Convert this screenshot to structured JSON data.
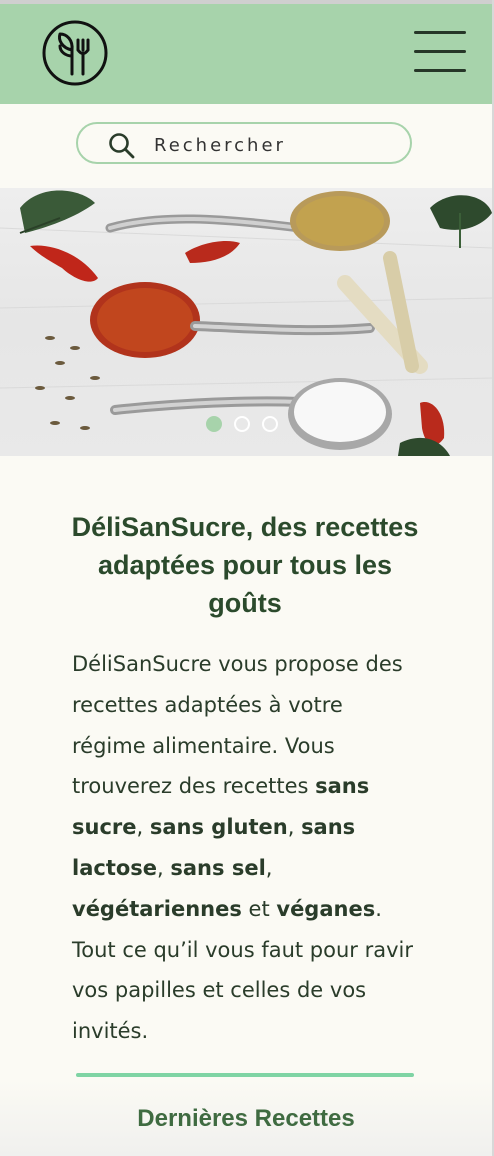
{
  "header": {
    "logo_icon": "leaf-fork-icon",
    "menu_icon": "hamburger-menu-icon"
  },
  "search": {
    "placeholder": "Rechercher",
    "icon": "search-icon"
  },
  "hero": {
    "image": "spices-on-spoons-photo",
    "carousel": {
      "count": 3,
      "active_index": 0
    }
  },
  "headline": "DéliSanSucre, des recettes adaptées pour tous les goûts",
  "intro": {
    "p1": "DéliSanSucre vous propose des recettes adaptées à votre régime alimentaire. Vous trouverez des recettes ",
    "b1": "sans sucre",
    "s1": ", ",
    "b2": "sans gluten",
    "s2": ", ",
    "b3": "sans lactose",
    "s3": ", ",
    "b4": "sans sel",
    "s4": ", ",
    "b5": "végétariennes",
    "s5": " et ",
    "b6": "véganes",
    "p2": ". Tout ce qu’il vous faut pour ravir vos papilles et celles de vos invités."
  },
  "latest": {
    "title": "Dernières Recettes"
  },
  "colors": {
    "header_bg": "#a7d3ab",
    "accent": "#7fd4a4",
    "text_dark": "#2b4a2c",
    "page_bg": "#fbfaf4",
    "dot_active": "#a7d3ab"
  }
}
